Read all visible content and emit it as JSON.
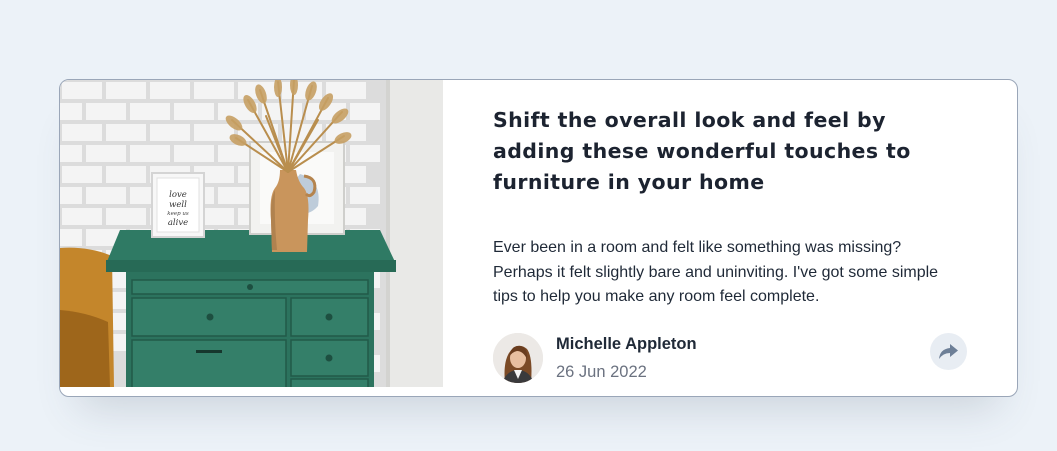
{
  "article": {
    "title": "Shift the overall look and feel by adding these wonderful touches to furniture in your home",
    "description": "Ever been in a room and felt like something was missing? Perhaps it felt slightly bare and uninviting. I've got some simple tips to help you make any room feel complete.",
    "image_icon": "drawers-photo",
    "frame_text": [
      "love",
      "well",
      "keep us",
      "alive"
    ]
  },
  "author": {
    "name": "Michelle Appleton",
    "date": "26 Jun 2022",
    "avatar_icon": "avatar-photo"
  },
  "share": {
    "icon": "share-icon"
  },
  "colors": {
    "background": "#ecf2f8",
    "card": "#ffffff",
    "title": "#1c2330",
    "text": "#1f2937",
    "muted": "#6b7280",
    "share_bg": "#e8edf3",
    "share_icon": "#6d7f97",
    "drawer_green": "#2f7a64"
  }
}
